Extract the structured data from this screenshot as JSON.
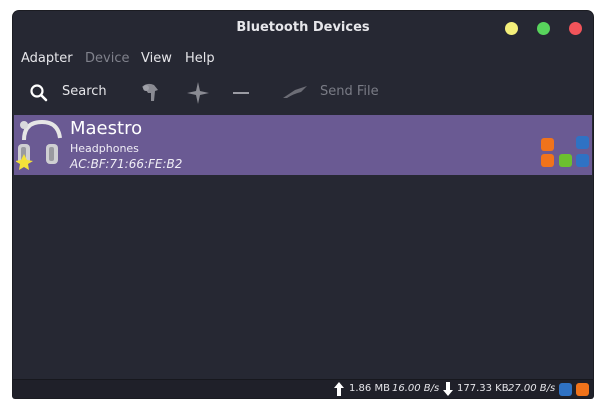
{
  "window": {
    "title": "Bluetooth Devices"
  },
  "window_controls": {
    "minimize_color": "#f4ef7a",
    "maximize_color": "#58d45c",
    "close_color": "#f1545a"
  },
  "menu": {
    "adapter": "Adapter",
    "device": "Device",
    "view": "View",
    "help": "Help"
  },
  "toolbar": {
    "search_label": "Search",
    "send_file_label": "Send File"
  },
  "devices": [
    {
      "name": "Maestro",
      "type": "Headphones",
      "address": "AC:BF:71:66:FE:B2",
      "icon": "headphones-icon",
      "status_icons": [
        "audio-sink-icon",
        "serial-icon",
        "audio-source-icon",
        "network-icon",
        "wifi-icon"
      ]
    }
  ],
  "statusbar": {
    "upload_total": "1.86 MB",
    "upload_rate": "16.00 B/s",
    "download_total": "177.33 KB",
    "download_rate": "27.00 B/s"
  },
  "colors": {
    "background": "#262833",
    "selection": "#6a5a93",
    "accent_orange": "#f0731b",
    "accent_blue": "#2f72c4",
    "accent_green": "#6cbf2f"
  }
}
